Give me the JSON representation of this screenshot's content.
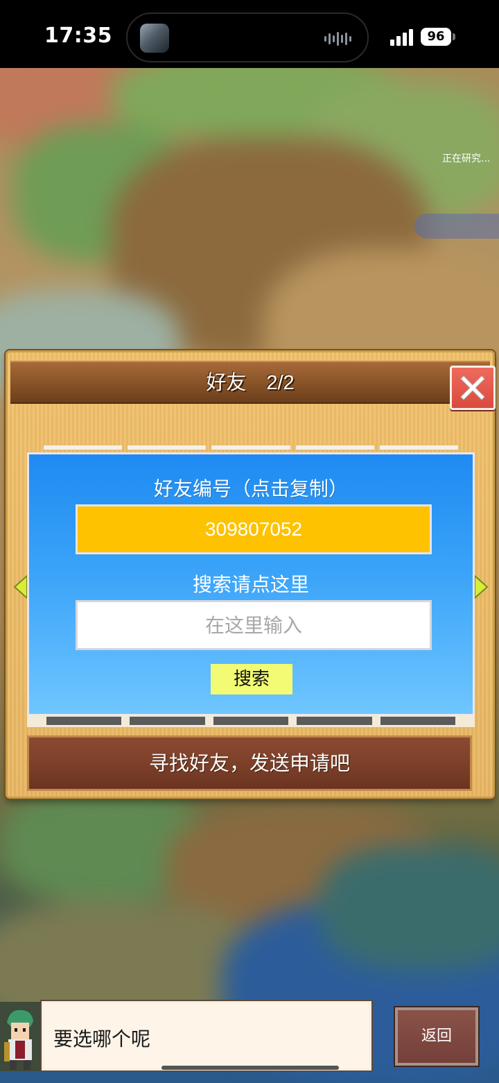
{
  "status_bar": {
    "time": "17:35",
    "battery": "96",
    "icons": [
      "app-thumbnail-icon",
      "audio-waveform-icon",
      "cellular-signal-icon",
      "battery-icon"
    ]
  },
  "background": {
    "research_status": "正在研究..."
  },
  "friend_dialog": {
    "title": "好友　2/2",
    "close_icon": "close-icon",
    "friend_id_label": "好友编号（点击复制）",
    "friend_id_value": "309807052",
    "search_label": "搜索请点这里",
    "search_placeholder": "在这里输入",
    "search_button": "搜索",
    "footer_message": "寻找好友，发送申请吧",
    "page_arrows": [
      "chevron-left-icon",
      "chevron-right-icon"
    ],
    "colors": {
      "panel_blue": "#1f8af2",
      "id_box_yellow": "#fec200",
      "search_button_yellow": "#f2fb73",
      "close_red": "#e35a4e"
    }
  },
  "bottom": {
    "npc_message": "要选哪个呢",
    "back_button": "返回"
  }
}
